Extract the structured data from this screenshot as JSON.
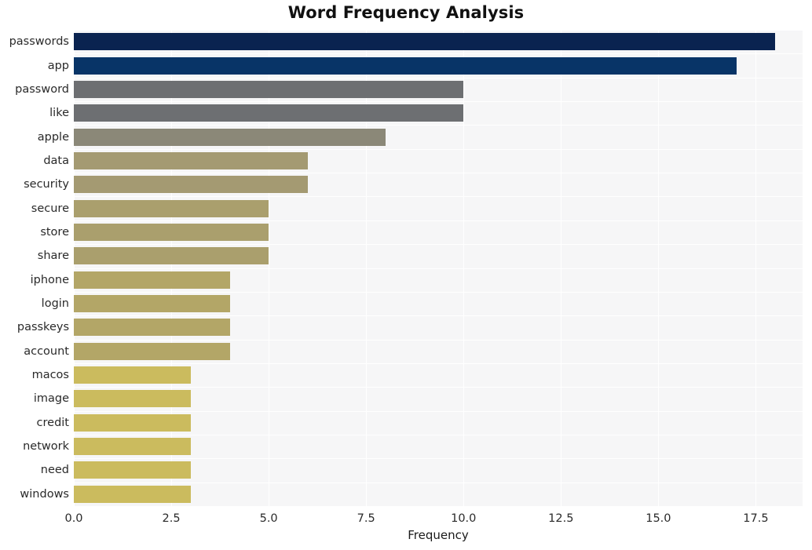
{
  "chart_data": {
    "type": "bar",
    "orientation": "horizontal",
    "title": "Word Frequency Analysis",
    "xlabel": "Frequency",
    "ylabel": "",
    "categories": [
      "passwords",
      "app",
      "password",
      "like",
      "apple",
      "data",
      "security",
      "secure",
      "store",
      "share",
      "iphone",
      "login",
      "passkeys",
      "account",
      "macos",
      "image",
      "credit",
      "network",
      "need",
      "windows"
    ],
    "values": [
      18,
      17,
      10,
      10,
      8,
      6,
      6,
      5,
      5,
      5,
      4,
      4,
      4,
      4,
      3,
      3,
      3,
      3,
      3,
      3
    ],
    "bar_colors": [
      "#0a2350",
      "#083467",
      "#6d6f72",
      "#6d6f72",
      "#8b8878",
      "#a49a72",
      "#a49a72",
      "#aa9f6d",
      "#aa9f6d",
      "#aa9f6d",
      "#b3a667",
      "#b3a667",
      "#b3a667",
      "#b3a667",
      "#cbbb5e",
      "#cbbb5e",
      "#cbbb5e",
      "#cbbb5e",
      "#cbbb5e",
      "#cbbb5e"
    ],
    "xlim": [
      0,
      18.7
    ],
    "xticks": [
      0.0,
      2.5,
      5.0,
      7.5,
      10.0,
      12.5,
      15.0,
      17.5
    ],
    "xtick_labels": [
      "0.0",
      "2.5",
      "5.0",
      "7.5",
      "10.0",
      "12.5",
      "15.0",
      "17.5"
    ],
    "grid": true,
    "grid_color": "#ffffff",
    "plot_background": "#f6f6f7",
    "legend": null
  }
}
